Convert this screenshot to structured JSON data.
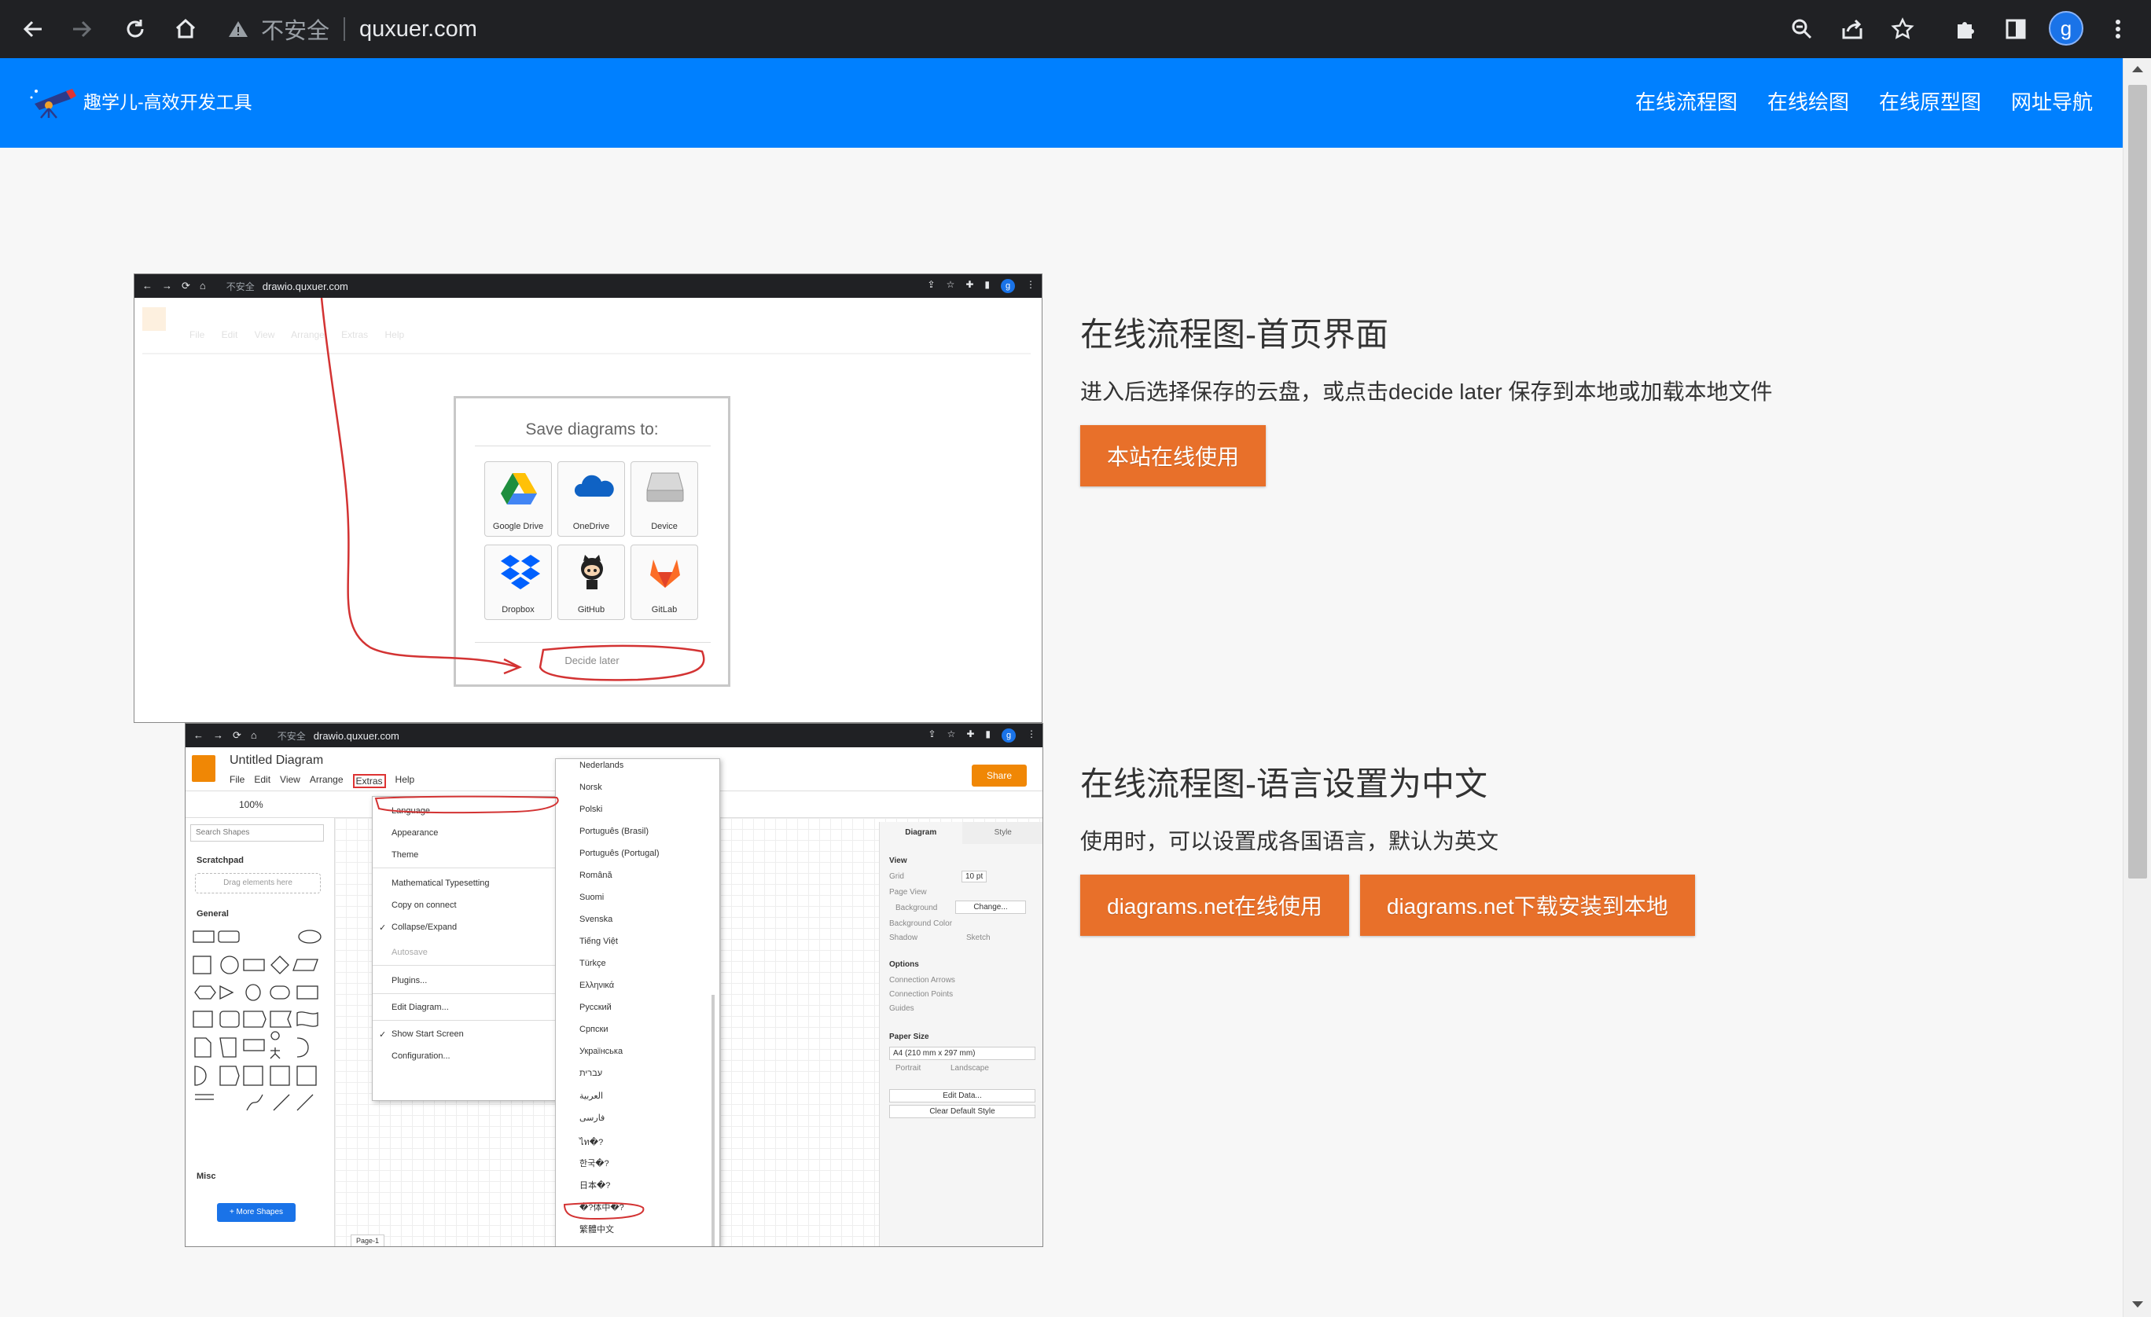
{
  "browser": {
    "insecure_label": "不安全",
    "url": "quxuer.com",
    "profile_initial": "g"
  },
  "site": {
    "logo_text": "趣学儿-高效开发工具",
    "nav": [
      "在线流程图",
      "在线绘图",
      "在线原型图",
      "网址导航"
    ]
  },
  "features": [
    {
      "title": "在线流程图-首页界面",
      "description": "进入后选择保存的云盘，或点击decide later 保存到本地或加载本地文件",
      "buttons": [
        "本站在线使用"
      ]
    },
    {
      "title": "在线流程图-语言设置为中文",
      "description": "使用时，可以设置成各国语言，默认为英文",
      "buttons": [
        "diagrams.net在线使用",
        "diagrams.net下载安装到本地"
      ]
    }
  ],
  "screenshot1": {
    "insecure_label": "不安全",
    "url": "drawio.quxuer.com",
    "profile_initial": "g",
    "faded_menu": "File Edit View Arrange Extras Help",
    "dialog_title": "Save diagrams to:",
    "options": [
      "Google Drive",
      "OneDrive",
      "Device",
      "Dropbox",
      "GitHub",
      "GitLab"
    ],
    "decide_later": "Decide later"
  },
  "screenshot2": {
    "insecure_label": "不安全",
    "url": "drawio.quxuer.com",
    "profile_initial": "g",
    "doc_title": "Untitled Diagram",
    "menu": [
      "File",
      "Edit",
      "View",
      "Arrange",
      "Extras",
      "Help"
    ],
    "share": "Share",
    "zoom": "100%",
    "search_placeholder": "Search Shapes",
    "scratchpad": "Scratchpad",
    "drag_hint": "Drag elements here",
    "general": "General",
    "misc": "Misc",
    "more_shapes": "+ More Shapes",
    "page_tab": "Page-1",
    "extras_items": [
      "Language",
      "Appearance",
      "Theme",
      "Mathematical Typesetting",
      "Copy on connect",
      "Collapse/Expand",
      "Autosave",
      "Plugins...",
      "Edit Diagram...",
      "Show Start Screen",
      "Configuration..."
    ],
    "languages": [
      "Nederlands",
      "Norsk",
      "Polski",
      "Português (Brasil)",
      "Português (Portugal)",
      "Română",
      "Suomi",
      "Svenska",
      "Tiếng Việt",
      "Türkçe",
      "Ελληνικά",
      "Русский",
      "Српски",
      "Українська",
      "עברית",
      "العربية",
      "فارسی",
      "ไท�?",
      "한국�?",
      "日本�?",
      "�?体中�?",
      "繁體中文"
    ],
    "tabs": [
      "Diagram",
      "Style"
    ],
    "panel": {
      "view": "View",
      "grid": "Grid",
      "grid_size": "10 pt",
      "page_view": "Page View",
      "background": "Background",
      "change": "Change...",
      "background_color": "Background Color",
      "shadow": "Shadow",
      "sketch": "Sketch",
      "options": "Options",
      "connection_arrows": "Connection Arrows",
      "connection_points": "Connection Points",
      "guides": "Guides",
      "paper_size": "Paper Size",
      "paper_value": "A4 (210 mm x 297 mm)",
      "portrait": "Portrait",
      "landscape": "Landscape",
      "edit_data": "Edit Data...",
      "clear_default": "Clear Default Style"
    }
  },
  "colors": {
    "header_blue": "#0080ff",
    "button_orange": "#e8702a",
    "annotation_red": "#d33333"
  }
}
